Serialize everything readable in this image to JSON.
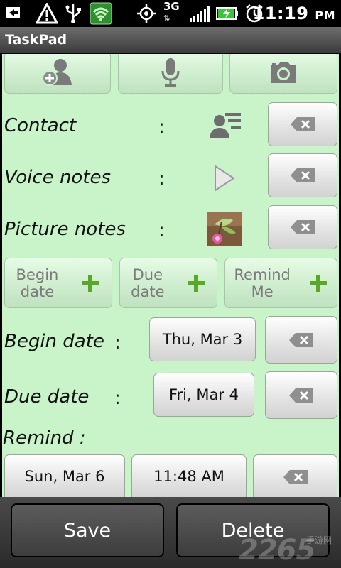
{
  "status_bar": {
    "network": "3G",
    "time": "11:19",
    "ampm": "PM"
  },
  "app": {
    "title": "TaskPad"
  },
  "top_buttons": [
    {
      "name": "add-contact",
      "icon": "add-contact-icon"
    },
    {
      "name": "voice-record",
      "icon": "microphone-icon"
    },
    {
      "name": "camera",
      "icon": "camera-icon"
    }
  ],
  "rows": {
    "contact": {
      "label": "Contact",
      "colon": ":"
    },
    "voice": {
      "label": "Voice notes",
      "colon": ":"
    },
    "picture": {
      "label": "Picture notes",
      "colon": ":"
    }
  },
  "add_buttons": {
    "begin": {
      "line1": "Begin",
      "line2": "date"
    },
    "due": {
      "line1": "Due",
      "line2": "date"
    },
    "remind": {
      "line1": "Remind",
      "line2": "Me"
    }
  },
  "dates": {
    "begin": {
      "label": "Begin date",
      "colon": ":",
      "value": "Thu, Mar 3"
    },
    "due": {
      "label": "Due date",
      "colon": ":",
      "value": "Fri, Mar 4"
    },
    "remind": {
      "label": "Remind :",
      "date": "Sun, Mar 6",
      "time": "11:48 AM"
    }
  },
  "bottom": {
    "save": "Save",
    "delete": "Delete"
  },
  "watermark": {
    "text": "2265",
    "sub": "手游网"
  }
}
